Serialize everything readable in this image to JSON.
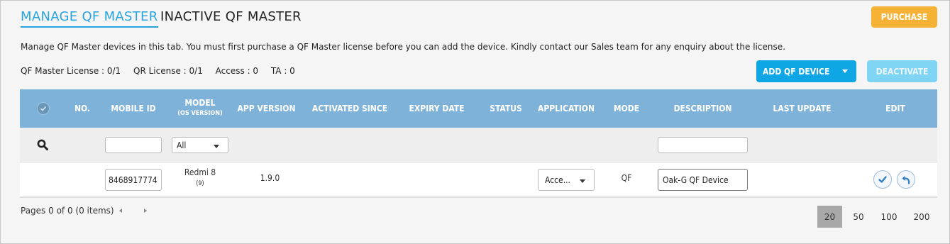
{
  "tabs": {
    "active": "MANAGE QF MASTER",
    "inactive": "INACTIVE QF MASTER"
  },
  "buttons": {
    "purchase": "PURCHASE",
    "add_device": "ADD QF DEVICE",
    "deactivate": "DEACTIVATE"
  },
  "description": "Manage QF Master devices in this tab. You must first purchase a QF Master license before you can add the device. Kindly contact our Sales team for any enquiry about the license.",
  "licenses": {
    "qf_master": "QF Master License : 0/1",
    "qr": "QR License : 0/1",
    "access": "Access : 0",
    "ta": "TA : 0"
  },
  "table": {
    "headers": {
      "no": "NO.",
      "mobile_id": "MOBILE ID",
      "model": "MODEL",
      "model_sub": "(OS VERSION)",
      "app_version": "APP VERSION",
      "activated_since": "ACTIVATED SINCE",
      "expiry_date": "EXPIRY DATE",
      "status": "STATUS",
      "application": "APPLICATION",
      "mode": "MODE",
      "description": "DESCRIPTION",
      "last_update": "LAST UPDATE",
      "edit": "EDIT"
    },
    "filters": {
      "mobile_id": "",
      "model": "All",
      "description": ""
    },
    "rows": [
      {
        "mobile_id": "8468917774",
        "model": "Redmi 8",
        "os_version": "(9)",
        "app_version": "1.9.0",
        "application": "Acce...",
        "mode": "QF",
        "description": "Oak-G QF Device"
      }
    ]
  },
  "pager": {
    "text": "Pages 0 of 0 (0 items)",
    "sizes": [
      "20",
      "50",
      "100",
      "200"
    ],
    "active_size": "20"
  },
  "colors": {
    "accent": "#29a3dc",
    "header_bg": "#7fb2d8",
    "purchase": "#f6b234",
    "add": "#0fa6e6",
    "deactivate": "#7fd3f3"
  }
}
